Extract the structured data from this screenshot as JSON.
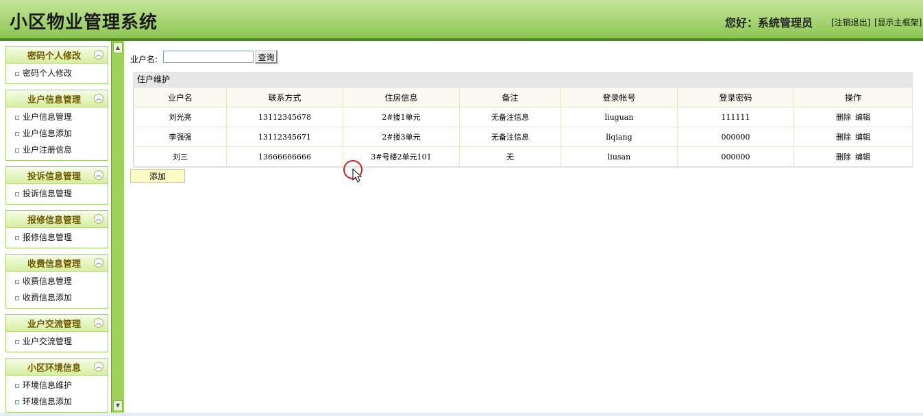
{
  "header": {
    "title": "小区物业管理系统",
    "greeting": "您好：系统管理员",
    "logout": "[注销退出]",
    "show_frame": "[显示主框架]"
  },
  "sidebar": {
    "groups": [
      {
        "title": "密码个人修改",
        "items": [
          "密码个人修改"
        ]
      },
      {
        "title": "业户信息管理",
        "items": [
          "业户信息管理",
          "业户信息添加",
          "业户注册信息"
        ]
      },
      {
        "title": "投诉信息管理",
        "items": [
          "投诉信息管理"
        ]
      },
      {
        "title": "报修信息管理",
        "items": [
          "报修信息管理"
        ]
      },
      {
        "title": "收费信息管理",
        "items": [
          "收费信息管理",
          "收费信息添加"
        ]
      },
      {
        "title": "业户交流管理",
        "items": [
          "业户交流管理"
        ]
      },
      {
        "title": "小区环境信息",
        "items": [
          "环境信息维护",
          "环境信息添加"
        ]
      }
    ]
  },
  "search": {
    "label": "业户名:",
    "value": "",
    "button": "查询"
  },
  "panel": {
    "title": "住户维护",
    "columns": [
      "业户名",
      "联系方式",
      "住房信息",
      "备注",
      "登录帐号",
      "登录密码",
      "操作"
    ],
    "rows": [
      {
        "name": "刘光亮",
        "phone": "13112345678",
        "house": "2#搂1单元",
        "note": "无备注信息",
        "account": "liuguan",
        "password": "111111"
      },
      {
        "name": "李强强",
        "phone": "13112345671",
        "house": "2#搂3单元",
        "note": "无备注信息",
        "account": "liqiang",
        "password": "000000"
      },
      {
        "name": "刘三",
        "phone": "13666666666",
        "house": "3#号楼2单元101",
        "note": "无",
        "account": "liusan",
        "password": "000000"
      }
    ],
    "op_delete": "删除",
    "op_edit": "编辑"
  },
  "add_button": "添加"
}
